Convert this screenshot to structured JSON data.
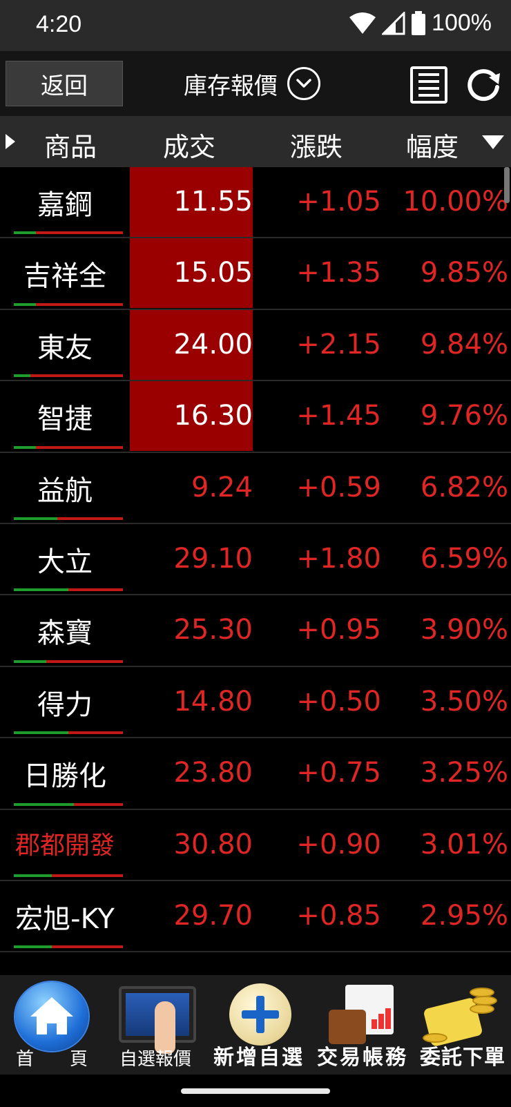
{
  "status_bar": {
    "time": "4:20",
    "battery": "100%"
  },
  "header": {
    "back_label": "返回",
    "title": "庫存報價"
  },
  "columns": {
    "name": "商品",
    "price": "成交",
    "change": "漲跌",
    "pct": "幅度"
  },
  "rows": [
    {
      "name": "嘉鋼",
      "price": "11.55",
      "change": "+1.05",
      "pct": "10.00%",
      "limit_up": true,
      "green_fraction": 0.2
    },
    {
      "name": "吉祥全",
      "price": "15.05",
      "change": "+1.35",
      "pct": "9.85%",
      "limit_up": true,
      "green_fraction": 0.2
    },
    {
      "name": "東友",
      "price": "24.00",
      "change": "+2.15",
      "pct": "9.84%",
      "limit_up": true,
      "green_fraction": 0.15
    },
    {
      "name": "智捷",
      "price": "16.30",
      "change": "+1.45",
      "pct": "9.76%",
      "limit_up": true,
      "green_fraction": 0.2
    },
    {
      "name": "益航",
      "price": "9.24",
      "change": "+0.59",
      "pct": "6.82%",
      "limit_up": false,
      "green_fraction": 0.4
    },
    {
      "name": "大立",
      "price": "29.10",
      "change": "+1.80",
      "pct": "6.59%",
      "limit_up": false,
      "green_fraction": 0.5
    },
    {
      "name": "森寶",
      "price": "25.30",
      "change": "+0.95",
      "pct": "3.90%",
      "limit_up": false,
      "green_fraction": 0.3
    },
    {
      "name": "得力",
      "price": "14.80",
      "change": "+0.50",
      "pct": "3.50%",
      "limit_up": false,
      "green_fraction": 0.5
    },
    {
      "name": "日勝化",
      "price": "23.80",
      "change": "+0.75",
      "pct": "3.25%",
      "limit_up": false,
      "green_fraction": 0.55
    },
    {
      "name": "郡都開發",
      "price": "30.80",
      "change": "+0.90",
      "pct": "3.01%",
      "limit_up": false,
      "green_fraction": 0.35,
      "name_red": true
    },
    {
      "name": "宏旭-KY",
      "price": "29.70",
      "change": "+0.85",
      "pct": "2.95%",
      "limit_up": false,
      "green_fraction": 0.35
    }
  ],
  "toolbar": {
    "home": "首　　頁",
    "watchlist": "自選報價",
    "add_watch": "新增自選",
    "account": "交易帳務",
    "order": "委託下單"
  }
}
